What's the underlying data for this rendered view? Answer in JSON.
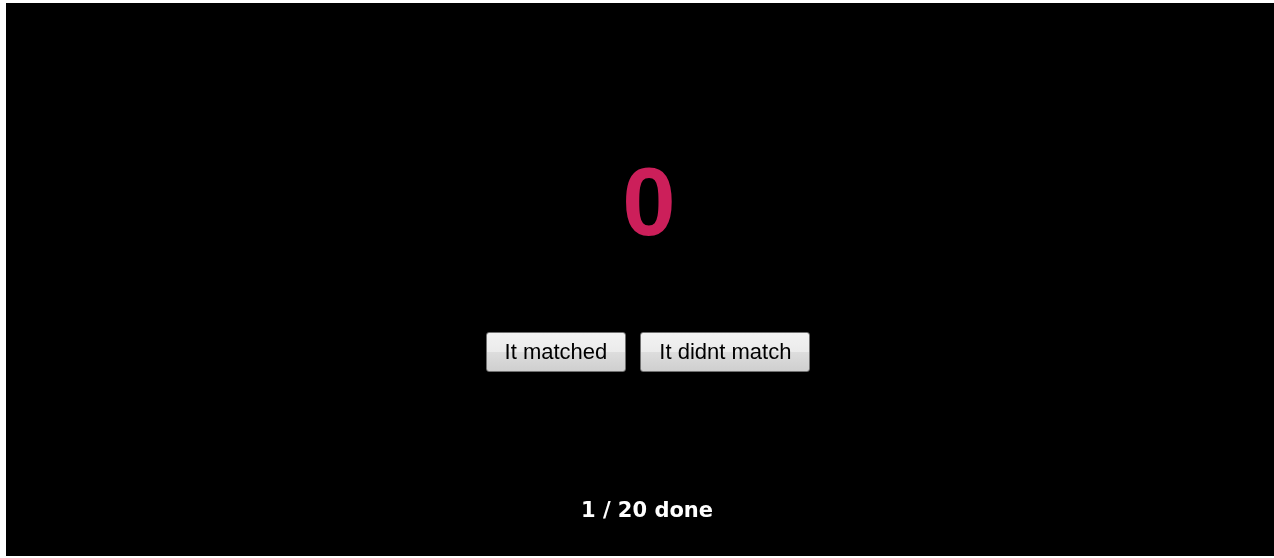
{
  "score": "0",
  "buttons": [
    "It matched",
    "It didnt match"
  ],
  "progress": "1 / 20 done"
}
